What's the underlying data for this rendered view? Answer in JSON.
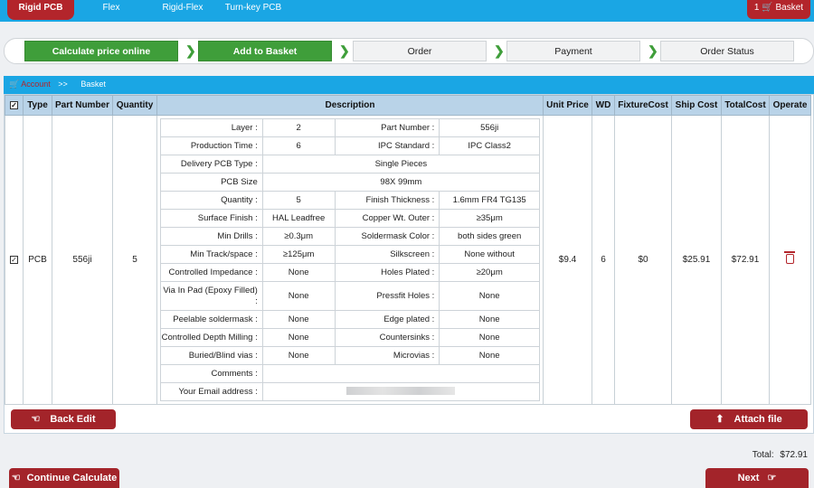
{
  "nav": {
    "tabs": [
      {
        "label": "Rigid PCB",
        "active": true
      },
      {
        "label": "Flex"
      },
      {
        "label": "Rigid-Flex"
      },
      {
        "label": "Turn-key PCB"
      }
    ],
    "basket_count": "1",
    "basket_label": "Basket"
  },
  "steps": [
    "Calculate price online",
    "Add to Basket",
    "Order",
    "Payment",
    "Order Status"
  ],
  "breadcrumb": {
    "account": "Account",
    "sep": ">>",
    "current": "Basket"
  },
  "table": {
    "headers": [
      "Type",
      "Part Number",
      "Quantity",
      "Description",
      "Unit Price",
      "WD",
      "FixtureCost",
      "Ship Cost",
      "TotalCost",
      "Operate"
    ],
    "row": {
      "type": "PCB",
      "part_number": "556ji",
      "quantity": "5",
      "unit_price": "$9.4",
      "wd": "6",
      "fixture_cost": "$0",
      "ship_cost": "$25.91",
      "total_cost": "$72.91"
    }
  },
  "desc": {
    "layer_label": "Layer :",
    "layer": "2",
    "part_number_label": "Part Number :",
    "part_number": "556ji",
    "production_time_label": "Production Time :",
    "production_time": "6",
    "ipc_label": "IPC Standard :",
    "ipc": "IPC Class2",
    "delivery_label": "Delivery PCB Type :",
    "delivery": "Single Pieces",
    "pcb_size_label": "PCB Size",
    "pcb_size": "98X  99mm",
    "quantity_label": "Quantity :",
    "quantity": "5",
    "finish_thickness_label": "Finish Thickness :",
    "finish_thickness": "1.6mm  FR4 TG135",
    "surface_finish_label": "Surface Finish :",
    "surface_finish": "HAL Leadfree",
    "copper_label": "Copper Wt. Outer :",
    "copper": "≥35μm",
    "min_drills_label": "Min Drills :",
    "min_drills": "≥0.3μm",
    "soldermask_label": "Soldermask Color :",
    "soldermask": "both sides  green",
    "min_track_label": "Min Track/space :",
    "min_track": "≥125μm",
    "silkscreen_label": "Silkscreen :",
    "silkscreen": "None  without",
    "impedance_label": "Controlled Impedance :",
    "impedance": "None",
    "holes_plated_label": "Holes Plated :",
    "holes_plated": "≥20μm",
    "via_label": "Via In Pad (Epoxy Filled) :",
    "via": "None",
    "pressfit_label": "Pressfit Holes :",
    "pressfit": "None",
    "peelable_label": "Peelable soldermask :",
    "peelable": "None",
    "edge_label": "Edge plated :",
    "edge": "None",
    "depth_label": "Controlled Depth Milling :",
    "depth": "None",
    "countersinks_label": "Countersinks :",
    "countersinks": "None",
    "buried_label": "Buried/Blind vias :",
    "buried": "None",
    "microvias_label": "Microvias :",
    "microvias": "None",
    "comments_label": "Comments :",
    "email_label": "Your Email address :"
  },
  "buttons": {
    "back_edit": "Back Edit",
    "attach": "Attach file",
    "continue": "Continue Calculate",
    "next": "Next"
  },
  "total": {
    "label": "Total:",
    "value": "$72.91"
  }
}
